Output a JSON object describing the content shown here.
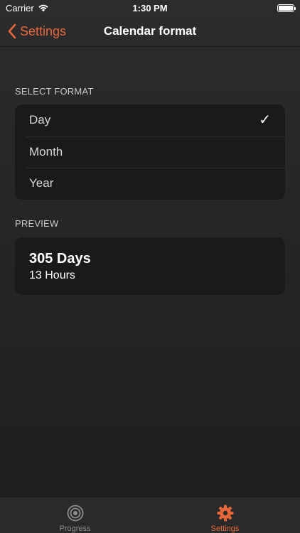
{
  "status_bar": {
    "carrier": "Carrier",
    "time": "1:30 PM"
  },
  "nav": {
    "back_label": "Settings",
    "title": "Calendar format"
  },
  "select_format": {
    "header": "SELECT FORMAT",
    "options": [
      {
        "label": "Day",
        "selected": true
      },
      {
        "label": "Month",
        "selected": false
      },
      {
        "label": "Year",
        "selected": false
      }
    ],
    "check_glyph": "✓"
  },
  "preview": {
    "header": "PREVIEW",
    "main": "305 Days",
    "sub": "13 Hours"
  },
  "tabs": [
    {
      "label": "Progress",
      "icon": "target-icon",
      "active": false
    },
    {
      "label": "Settings",
      "icon": "gear-icon",
      "active": true
    }
  ],
  "colors": {
    "accent": "#e8673a",
    "card": "#1a1a1a",
    "inactive": "#8c8c8c"
  }
}
